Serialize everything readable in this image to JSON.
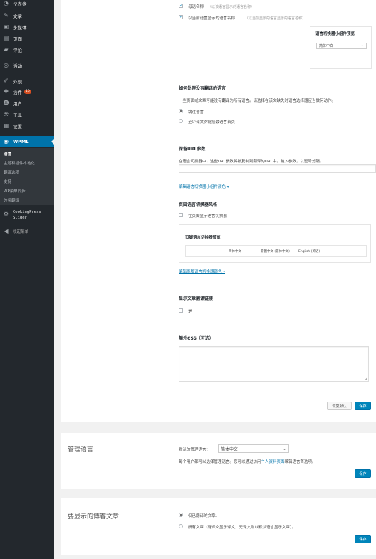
{
  "sidebar": {
    "items": [
      {
        "label": "仪表盘",
        "icon": "dashboard-icon",
        "glyph": "◔"
      },
      {
        "label": "文章",
        "icon": "pushpin-icon",
        "glyph": "✎"
      },
      {
        "label": "多媒体",
        "icon": "media-icon",
        "glyph": "▣"
      },
      {
        "label": "页面",
        "icon": "page-icon",
        "glyph": "▤"
      },
      {
        "label": "评论",
        "icon": "comment-icon",
        "glyph": "▰"
      },
      {
        "label": "活动",
        "icon": "activity-icon",
        "glyph": "◎"
      },
      {
        "label": "外观",
        "icon": "appearance-icon",
        "glyph": "✐"
      },
      {
        "label": "插件",
        "icon": "plugin-icon",
        "glyph": "✚",
        "badge": "10"
      },
      {
        "label": "用户",
        "icon": "users-icon",
        "glyph": "☻"
      },
      {
        "label": "工具",
        "icon": "tools-icon",
        "glyph": "⚒"
      },
      {
        "label": "设置",
        "icon": "settings-icon",
        "glyph": "▦"
      },
      {
        "label": "WPML",
        "icon": "wpml-icon",
        "glyph": "◉"
      }
    ],
    "submenu": [
      "语言",
      "主题和插件本地化",
      "翻译选项",
      "支持",
      "WP菜单同步",
      "分类翻译"
    ],
    "cookingpress": [
      "CookingPress",
      "Slider"
    ],
    "collapse": "收起菜单"
  },
  "language_names": {
    "native_label": "母语名称",
    "native_hint": "（以该语言显示的语言名称）",
    "current_label": "以当前语言显示的语言名称",
    "current_hint": "（以当前显示的语言显示的语言名称）",
    "widget_preview_title": "语言切换器小组件预览",
    "widget_select_value": "简体中文"
  },
  "untranslated": {
    "title": "如何处理没有翻译的语言",
    "desc": "一些页面或文章可能没有翻译为所有语言。请选择在该文缺失时语言选择器应当做何动作。",
    "options": [
      "跳过语言",
      "至少译文例链接最语言首页"
    ]
  },
  "url_params": {
    "title": "保留URL参数",
    "desc": "在语言切换器中，这些URL参数将被复制到翻译的URL中。输入参数，以逗号分隔。",
    "edit_link": "编辑语言切换器小组件颜色 ▾"
  },
  "footer_switcher": {
    "title": "页脚语言切换器风格",
    "checkbox_label": "在页脚显示语言切换器",
    "preview_title": "页脚语言切换器预览",
    "preview_langs": [
      "简体中文",
      "繁體中文 (繁体中文)",
      "English (英语)"
    ],
    "edit_link": "编辑页脚语言切换器颜色 ▾"
  },
  "post_links": {
    "title": "显示文章翻译链接",
    "checkbox_label": "是"
  },
  "custom_css": {
    "title": "额外CSS（可选）"
  },
  "buttons": {
    "restore_default": "恢复默认",
    "save": "保存"
  },
  "admin_language": {
    "heading": "管理语言",
    "label": "默认的管理语言：",
    "value": "简体中文",
    "desc_before": "每个用户都可以选择管理语言。您可以通过访问",
    "desc_link": "个人资料页面",
    "desc_after": "编辑语言首选项。"
  },
  "blog_posts": {
    "heading": "要显示的博客文章",
    "options": [
      "仅已翻译的文章。",
      "所有文章（有译文显示译文，无译文则以默认语言显示文章）。"
    ]
  }
}
